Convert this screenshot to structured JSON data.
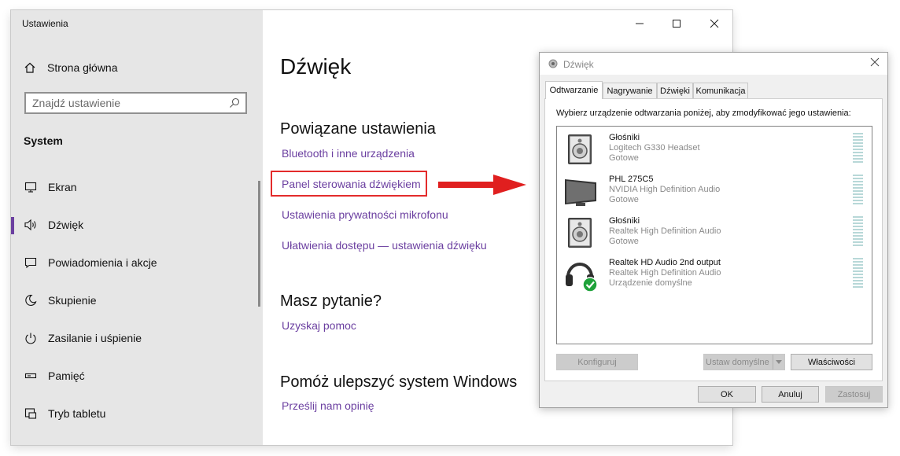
{
  "settings": {
    "window_title": "Ustawienia",
    "home_label": "Strona główna",
    "search_placeholder": "Znajdź ustawienie",
    "section_label": "System",
    "nav": [
      {
        "label": "Ekran",
        "icon": "monitor-icon"
      },
      {
        "label": "Dźwięk",
        "icon": "speaker-icon",
        "active": true
      },
      {
        "label": "Powiadomienia i akcje",
        "icon": "notification-icon"
      },
      {
        "label": "Skupienie",
        "icon": "moon-icon"
      },
      {
        "label": "Zasilanie i uśpienie",
        "icon": "power-icon"
      },
      {
        "label": "Pamięć",
        "icon": "storage-icon"
      },
      {
        "label": "Tryb tabletu",
        "icon": "tablet-icon"
      }
    ],
    "page_title": "Dźwięk",
    "related_heading": "Powiązane ustawienia",
    "related_links": [
      "Bluetooth i inne urządzenia",
      "Panel sterowania dźwiękiem",
      "Ustawienia prywatności mikrofonu",
      "Ułatwienia dostępu — ustawienia dźwięku"
    ],
    "question_heading": "Masz pytanie?",
    "help_link": "Uzyskaj pomoc",
    "improve_heading": "Pomóż ulepszyć system Windows",
    "feedback_link": "Prześlij nam opinię"
  },
  "dialog": {
    "title": "Dźwięk",
    "tabs": [
      "Odtwarzanie",
      "Nagrywanie",
      "Dźwięki",
      "Komunikacja"
    ],
    "instruction": "Wybierz urządzenie odtwarzania poniżej, aby zmodyfikować jego ustawienia:",
    "devices": [
      {
        "name": "Głośniki",
        "driver": "Logitech G330 Headset",
        "status": "Gotowe",
        "icon": "speaker-device-icon"
      },
      {
        "name": "PHL 275C5",
        "driver": "NVIDIA High Definition Audio",
        "status": "Gotowe",
        "icon": "monitor-device-icon"
      },
      {
        "name": "Głośniki",
        "driver": "Realtek High Definition Audio",
        "status": "Gotowe",
        "icon": "speaker-device-icon"
      },
      {
        "name": "Realtek HD Audio 2nd output",
        "driver": "Realtek High Definition Audio",
        "status": "Urządzenie domyślne",
        "icon": "headphones-default-icon"
      }
    ],
    "buttons": {
      "configure": "Konfiguruj",
      "set_default": "Ustaw domyślne",
      "properties": "Właściwości",
      "ok": "OK",
      "cancel": "Anuluj",
      "apply": "Zastosuj"
    }
  },
  "colors": {
    "accent": "#6b3fa0",
    "highlight_box": "#e32b2b",
    "arrow": "#e01f1f",
    "default_check": "#1fa23a"
  }
}
